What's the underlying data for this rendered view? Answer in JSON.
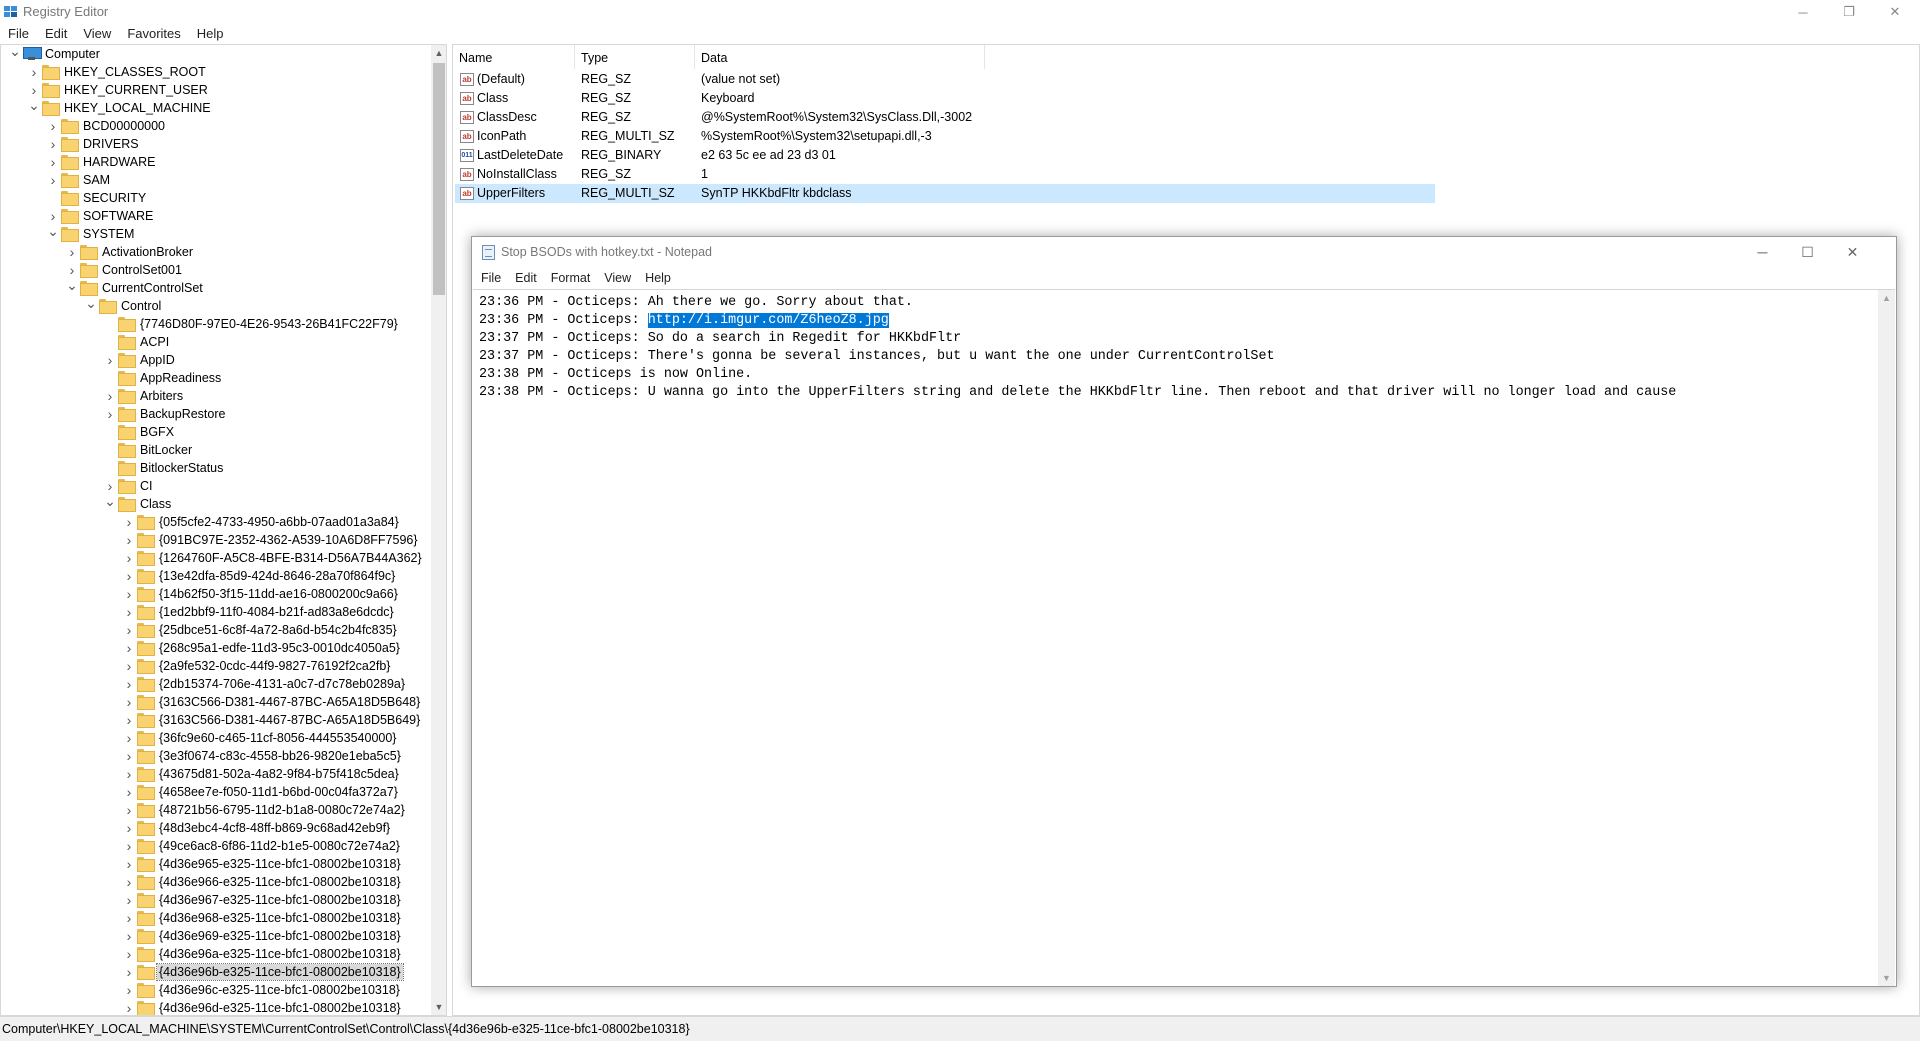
{
  "window": {
    "title": "Registry Editor",
    "minimize": "─",
    "restore": "❐",
    "close": "✕"
  },
  "menu": [
    "File",
    "Edit",
    "View",
    "Favorites",
    "Help"
  ],
  "tree": {
    "items": [
      {
        "label": "Computer",
        "level": 0,
        "expand": "v",
        "icon": "computer-icon"
      },
      {
        "label": "HKEY_CLASSES_ROOT",
        "level": 1,
        "expand": ">",
        "icon": "folder-icon"
      },
      {
        "label": "HKEY_CURRENT_USER",
        "level": 1,
        "expand": ">",
        "icon": "folder-icon"
      },
      {
        "label": "HKEY_LOCAL_MACHINE",
        "level": 1,
        "expand": "v",
        "icon": "folder-icon"
      },
      {
        "label": "BCD00000000",
        "level": 2,
        "expand": ">",
        "icon": "folder-icon"
      },
      {
        "label": "DRIVERS",
        "level": 2,
        "expand": ">",
        "icon": "folder-icon"
      },
      {
        "label": "HARDWARE",
        "level": 2,
        "expand": ">",
        "icon": "folder-icon"
      },
      {
        "label": "SAM",
        "level": 2,
        "expand": ">",
        "icon": "folder-icon"
      },
      {
        "label": "SECURITY",
        "level": 2,
        "expand": "",
        "icon": "folder-icon"
      },
      {
        "label": "SOFTWARE",
        "level": 2,
        "expand": ">",
        "icon": "folder-icon"
      },
      {
        "label": "SYSTEM",
        "level": 2,
        "expand": "v",
        "icon": "folder-icon"
      },
      {
        "label": "ActivationBroker",
        "level": 3,
        "expand": ">",
        "icon": "folder-icon"
      },
      {
        "label": "ControlSet001",
        "level": 3,
        "expand": ">",
        "icon": "folder-icon"
      },
      {
        "label": "CurrentControlSet",
        "level": 3,
        "expand": "v",
        "icon": "folder-icon"
      },
      {
        "label": "Control",
        "level": 4,
        "expand": "v",
        "icon": "folder-icon"
      },
      {
        "label": "{7746D80F-97E0-4E26-9543-26B41FC22F79}",
        "level": 5,
        "expand": "",
        "icon": "folder-icon"
      },
      {
        "label": "ACPI",
        "level": 5,
        "expand": "",
        "icon": "folder-icon"
      },
      {
        "label": "AppID",
        "level": 5,
        "expand": ">",
        "icon": "folder-icon"
      },
      {
        "label": "AppReadiness",
        "level": 5,
        "expand": "",
        "icon": "folder-icon"
      },
      {
        "label": "Arbiters",
        "level": 5,
        "expand": ">",
        "icon": "folder-icon"
      },
      {
        "label": "BackupRestore",
        "level": 5,
        "expand": ">",
        "icon": "folder-icon"
      },
      {
        "label": "BGFX",
        "level": 5,
        "expand": "",
        "icon": "folder-icon"
      },
      {
        "label": "BitLocker",
        "level": 5,
        "expand": "",
        "icon": "folder-icon"
      },
      {
        "label": "BitlockerStatus",
        "level": 5,
        "expand": "",
        "icon": "folder-icon"
      },
      {
        "label": "CI",
        "level": 5,
        "expand": ">",
        "icon": "folder-icon"
      },
      {
        "label": "Class",
        "level": 5,
        "expand": "v",
        "icon": "folder-icon"
      },
      {
        "label": "{05f5cfe2-4733-4950-a6bb-07aad01a3a84}",
        "level": 6,
        "expand": ">",
        "icon": "folder-icon"
      },
      {
        "label": "{091BC97E-2352-4362-A539-10A6D8FF7596}",
        "level": 6,
        "expand": ">",
        "icon": "folder-icon"
      },
      {
        "label": "{1264760F-A5C8-4BFE-B314-D56A7B44A362}",
        "level": 6,
        "expand": ">",
        "icon": "folder-icon"
      },
      {
        "label": "{13e42dfa-85d9-424d-8646-28a70f864f9c}",
        "level": 6,
        "expand": ">",
        "icon": "folder-icon"
      },
      {
        "label": "{14b62f50-3f15-11dd-ae16-0800200c9a66}",
        "level": 6,
        "expand": ">",
        "icon": "folder-icon"
      },
      {
        "label": "{1ed2bbf9-11f0-4084-b21f-ad83a8e6dcdc}",
        "level": 6,
        "expand": ">",
        "icon": "folder-icon"
      },
      {
        "label": "{25dbce51-6c8f-4a72-8a6d-b54c2b4fc835}",
        "level": 6,
        "expand": ">",
        "icon": "folder-icon"
      },
      {
        "label": "{268c95a1-edfe-11d3-95c3-0010dc4050a5}",
        "level": 6,
        "expand": ">",
        "icon": "folder-icon"
      },
      {
        "label": "{2a9fe532-0cdc-44f9-9827-76192f2ca2fb}",
        "level": 6,
        "expand": ">",
        "icon": "folder-icon"
      },
      {
        "label": "{2db15374-706e-4131-a0c7-d7c78eb0289a}",
        "level": 6,
        "expand": ">",
        "icon": "folder-icon"
      },
      {
        "label": "{3163C566-D381-4467-87BC-A65A18D5B648}",
        "level": 6,
        "expand": ">",
        "icon": "folder-icon"
      },
      {
        "label": "{3163C566-D381-4467-87BC-A65A18D5B649}",
        "level": 6,
        "expand": ">",
        "icon": "folder-icon"
      },
      {
        "label": "{36fc9e60-c465-11cf-8056-444553540000}",
        "level": 6,
        "expand": ">",
        "icon": "folder-icon"
      },
      {
        "label": "{3e3f0674-c83c-4558-bb26-9820e1eba5c5}",
        "level": 6,
        "expand": ">",
        "icon": "folder-icon"
      },
      {
        "label": "{43675d81-502a-4a82-9f84-b75f418c5dea}",
        "level": 6,
        "expand": ">",
        "icon": "folder-icon"
      },
      {
        "label": "{4658ee7e-f050-11d1-b6bd-00c04fa372a7}",
        "level": 6,
        "expand": ">",
        "icon": "folder-icon"
      },
      {
        "label": "{48721b56-6795-11d2-b1a8-0080c72e74a2}",
        "level": 6,
        "expand": ">",
        "icon": "folder-icon"
      },
      {
        "label": "{48d3ebc4-4cf8-48ff-b869-9c68ad42eb9f}",
        "level": 6,
        "expand": ">",
        "icon": "folder-icon"
      },
      {
        "label": "{49ce6ac8-6f86-11d2-b1e5-0080c72e74a2}",
        "level": 6,
        "expand": ">",
        "icon": "folder-icon"
      },
      {
        "label": "{4d36e965-e325-11ce-bfc1-08002be10318}",
        "level": 6,
        "expand": ">",
        "icon": "folder-icon"
      },
      {
        "label": "{4d36e966-e325-11ce-bfc1-08002be10318}",
        "level": 6,
        "expand": ">",
        "icon": "folder-icon"
      },
      {
        "label": "{4d36e967-e325-11ce-bfc1-08002be10318}",
        "level": 6,
        "expand": ">",
        "icon": "folder-icon"
      },
      {
        "label": "{4d36e968-e325-11ce-bfc1-08002be10318}",
        "level": 6,
        "expand": ">",
        "icon": "folder-icon"
      },
      {
        "label": "{4d36e969-e325-11ce-bfc1-08002be10318}",
        "level": 6,
        "expand": ">",
        "icon": "folder-icon"
      },
      {
        "label": "{4d36e96a-e325-11ce-bfc1-08002be10318}",
        "level": 6,
        "expand": ">",
        "icon": "folder-icon"
      },
      {
        "label": "{4d36e96b-e325-11ce-bfc1-08002be10318}",
        "level": 6,
        "expand": ">",
        "icon": "folder-icon",
        "selected": true
      },
      {
        "label": "{4d36e96c-e325-11ce-bfc1-08002be10318}",
        "level": 6,
        "expand": ">",
        "icon": "folder-icon"
      },
      {
        "label": "{4d36e96d-e325-11ce-bfc1-08002be10318}",
        "level": 6,
        "expand": ">",
        "icon": "folder-icon"
      }
    ]
  },
  "values": {
    "headers": {
      "name": "Name",
      "type": "Type",
      "data": "Data"
    },
    "rows": [
      {
        "name": "(Default)",
        "type": "REG_SZ",
        "data": "(value not set)",
        "icon": "ab"
      },
      {
        "name": "Class",
        "type": "REG_SZ",
        "data": "Keyboard",
        "icon": "ab"
      },
      {
        "name": "ClassDesc",
        "type": "REG_SZ",
        "data": "@%SystemRoot%\\System32\\SysClass.Dll,-3002",
        "icon": "ab"
      },
      {
        "name": "IconPath",
        "type": "REG_MULTI_SZ",
        "data": "%SystemRoot%\\System32\\setupapi.dll,-3",
        "icon": "ab"
      },
      {
        "name": "LastDeleteDate",
        "type": "REG_BINARY",
        "data": "e2 63 5c ee ad 23 d3 01",
        "icon": "011"
      },
      {
        "name": "NoInstallClass",
        "type": "REG_SZ",
        "data": "1",
        "icon": "ab"
      },
      {
        "name": "UpperFilters",
        "type": "REG_MULTI_SZ",
        "data": "SynTP HKKbdFltr kbdclass",
        "icon": "ab",
        "selected": true
      }
    ]
  },
  "statusbar": {
    "path": "Computer\\HKEY_LOCAL_MACHINE\\SYSTEM\\CurrentControlSet\\Control\\Class\\{4d36e96b-e325-11ce-bfc1-08002be10318}"
  },
  "notepad": {
    "title": "Stop BSODs with hotkey.txt - Notepad",
    "minimize": "─",
    "maximize": "☐",
    "close": "✕",
    "menu": [
      "File",
      "Edit",
      "Format",
      "View",
      "Help"
    ],
    "lines": [
      {
        "text": "23:36 PM - Octiceps: Ah there we go. Sorry about that."
      },
      {
        "text": "23:36 PM - Octiceps: ",
        "highlight": "http://i.imgur.com/Z6heoZ8.jpg"
      },
      {
        "text": "23:37 PM - Octiceps: So do a search in Regedit for HKKbdFltr"
      },
      {
        "text": "23:37 PM - Octiceps: There's gonna be several instances, but u want the one under CurrentControlSet"
      },
      {
        "text": "23:38 PM - Octiceps is now Online."
      },
      {
        "text": "23:38 PM - Octiceps: U wanna go into the UpperFilters string and delete the HKKbdFltr line. Then reboot and that driver will no longer load and cause"
      }
    ]
  },
  "colors": {
    "selection": "#0078d7",
    "row_selected": "#cce8ff",
    "folder": "#f9d36f"
  }
}
